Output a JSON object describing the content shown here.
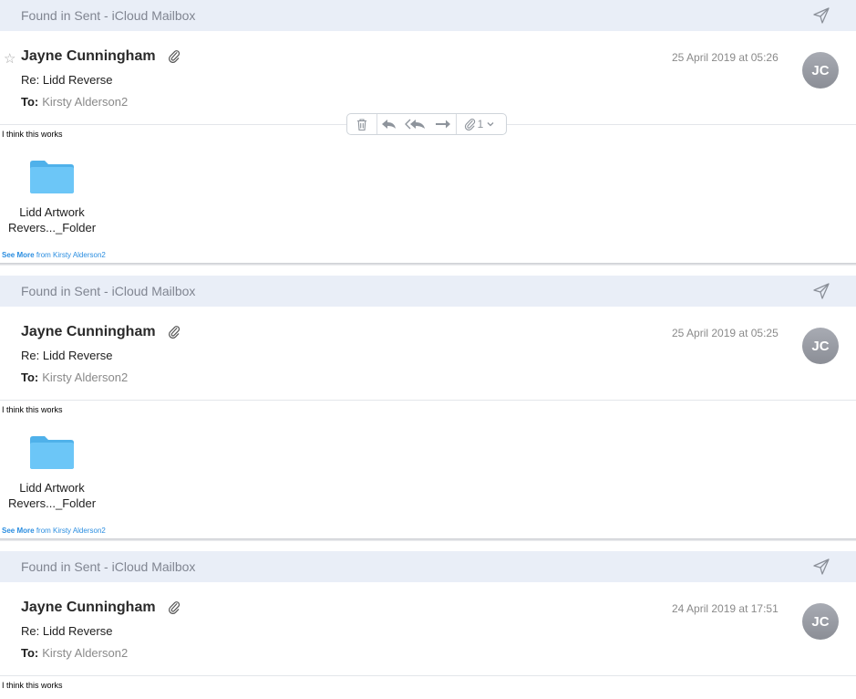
{
  "messages": [
    {
      "found_in": "Found in Sent - iCloud Mailbox",
      "star": "☆",
      "sender": "Jayne Cunningham",
      "date": "25 April 2019 at 05:26",
      "avatar_initials": "JC",
      "subject": "Re: Lidd Reverse",
      "to_label": "To:",
      "to_name": "Kirsty Alderson2",
      "body": "I think this works",
      "attachment_name_line1": "Lidd Artwork",
      "attachment_name_line2": "Revers..._Folder",
      "see_more_label": "See More",
      "see_more_from": "from Kirsty Alderson2"
    },
    {
      "found_in": "Found in Sent - iCloud Mailbox",
      "sender": "Jayne Cunningham",
      "date": "25 April 2019 at 05:25",
      "avatar_initials": "JC",
      "subject": "Re: Lidd Reverse",
      "to_label": "To:",
      "to_name": "Kirsty Alderson2",
      "body": "I think this works",
      "attachment_name_line1": "Lidd Artwork",
      "attachment_name_line2": "Revers..._Folder",
      "see_more_label": "See More",
      "see_more_from": "from Kirsty Alderson2"
    },
    {
      "found_in": "Found in Sent - iCloud Mailbox",
      "sender": "Jayne Cunningham",
      "date": "24 April 2019 at 17:51",
      "avatar_initials": "JC",
      "subject": "Re: Lidd Reverse",
      "to_label": "To:",
      "to_name": "Kirsty Alderson2",
      "body": "I think this works"
    }
  ],
  "toolbar": {
    "attachment_count": "1",
    "icons": [
      "trash-icon",
      "reply-icon",
      "reply-all-icon",
      "forward-icon",
      "paperclip-icon",
      "chevron-down-icon"
    ]
  },
  "colors": {
    "found_bar_bg": "#e9eef7",
    "link_blue": "#2a8de0",
    "folder_blue": "#5ec0f5",
    "avatar_gray": "#9a9da5"
  }
}
